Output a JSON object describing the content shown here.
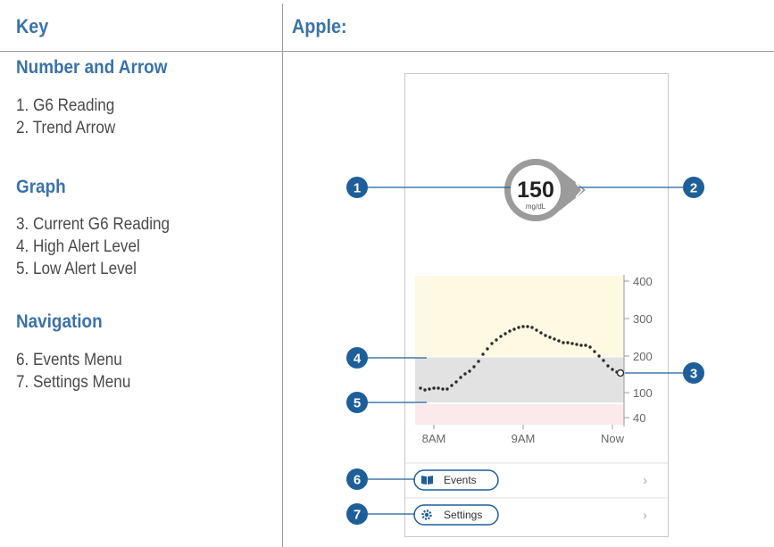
{
  "key_header": "Key",
  "apple_header": "Apple:",
  "sections": [
    {
      "title": "Number and Arrow",
      "items": [
        "1. G6 Reading",
        "2. Trend Arrow"
      ]
    },
    {
      "title": "Graph",
      "items": [
        "3. Current G6 Reading",
        "4. High Alert Level",
        "5. Low Alert Level"
      ]
    },
    {
      "title": "Navigation",
      "items": [
        "6. Events Menu",
        "7. Settings Menu"
      ]
    }
  ],
  "reading": {
    "value": "150",
    "unit": "mg/dL"
  },
  "graph": {
    "y_ticks": [
      "400",
      "300",
      "200",
      "100",
      "40"
    ],
    "x_ticks": [
      "8AM",
      "9AM",
      "Now"
    ]
  },
  "menu": {
    "events_label": "Events",
    "settings_label": "Settings",
    "chevron": "›"
  },
  "callouts": [
    "1",
    "2",
    "3",
    "4",
    "5",
    "6",
    "7"
  ],
  "colors": {
    "accent": "#3b72a8",
    "callout": "#1e5f99",
    "high_zone": "#fdf9e3",
    "target_zone": "#e2e2e2",
    "low_zone": "#fbe9ec",
    "reading_ring": "#9b9b9b"
  }
}
